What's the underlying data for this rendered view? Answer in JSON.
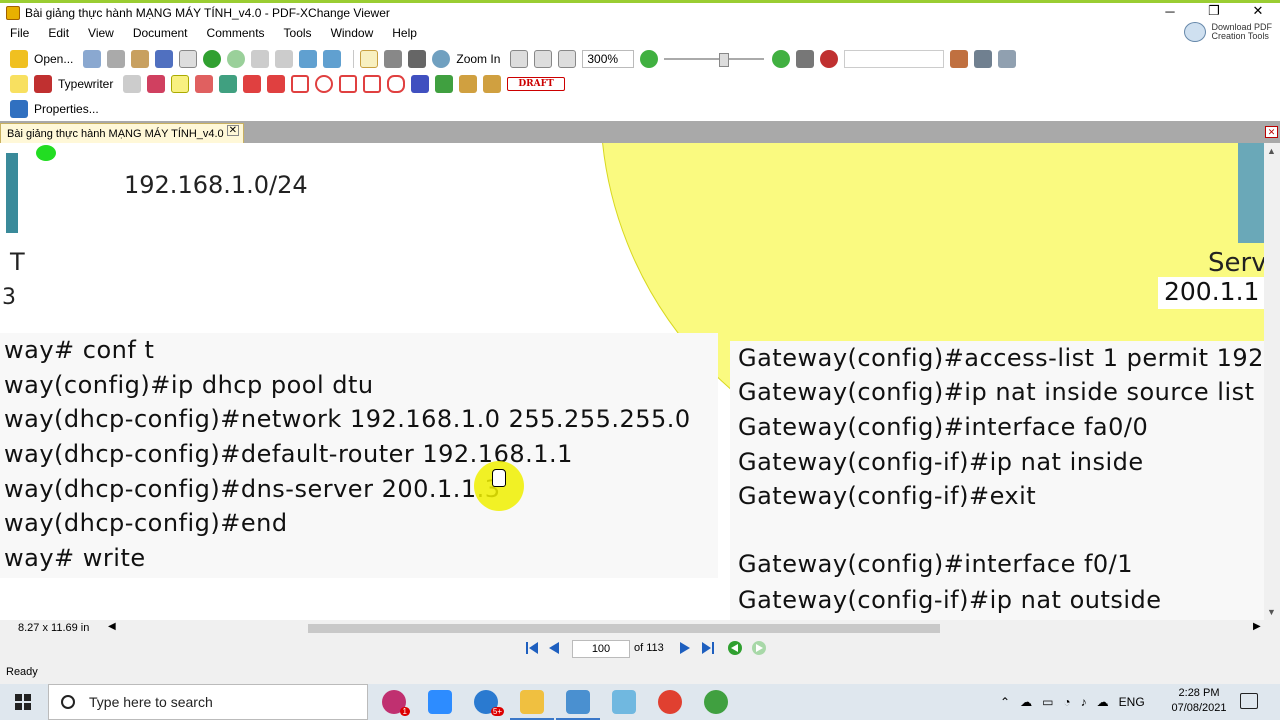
{
  "window": {
    "title": "Bài giảng thực hành MẠNG MÁY TÍNH_v4.0 - PDF-XChange Viewer",
    "controls": [
      "─",
      "❐",
      "✕"
    ]
  },
  "menu": [
    "File",
    "Edit",
    "View",
    "Document",
    "Comments",
    "Tools",
    "Window",
    "Help"
  ],
  "download_pdf": {
    "line1": "Download PDF",
    "line2": "Creation Tools"
  },
  "toolbar1": {
    "open_label": "Open...",
    "zoom_in_label": "Zoom In",
    "zoom_value": "300%"
  },
  "toolbar2": {
    "typewriter_label": "Typewriter",
    "draft_label": "DRAFT"
  },
  "toolbar3": {
    "properties_label": "Properties..."
  },
  "doc_tab": {
    "label": "Bài giảng thực hành MẠNG MÁY TÍNH_v4.0",
    "close": "✕"
  },
  "page": {
    "network_label": "192.168.1.0/24",
    "left_fragment_t": "T",
    "left_fragment_b": "3",
    "server_label": "Serv",
    "server_ip": "200.1.1",
    "left_commands": [
      "way# conf t",
      "way(config)#ip dhcp pool dtu",
      "way(dhcp-config)#network 192.168.1.0 255.255.255.0",
      "way(dhcp-config)#default-router 192.168.1.1",
      "way(dhcp-config)#dns-server 200.1.1.3",
      "way(dhcp-config)#end",
      "way# write"
    ],
    "right_commands": [
      "Gateway(config)#access-list 1 permit 192",
      "Gateway(config)#ip nat inside source list",
      "Gateway(config)#interface fa0/0",
      "Gateway(config-if)#ip nat inside",
      "Gateway(config-if)#exit",
      "",
      "Gateway(config)#interface f0/1",
      "Gateway(config-if)#ip nat outside"
    ]
  },
  "status": {
    "page_size": "8.27 x 11.69 in",
    "current_page": "100",
    "total_pages": "of 113",
    "ready": "Ready"
  },
  "taskbar": {
    "search_placeholder": "Type here to search",
    "language": "ENG",
    "time": "2:28 PM",
    "date": "07/08/2021",
    "badge_1": "1",
    "badge_2": "5+"
  },
  "colors": {
    "circle_fill": "#fafa80",
    "cursor_highlight": "#f0f000",
    "tab_bg": "#fff8d8",
    "title_accent": "#9acd32"
  }
}
